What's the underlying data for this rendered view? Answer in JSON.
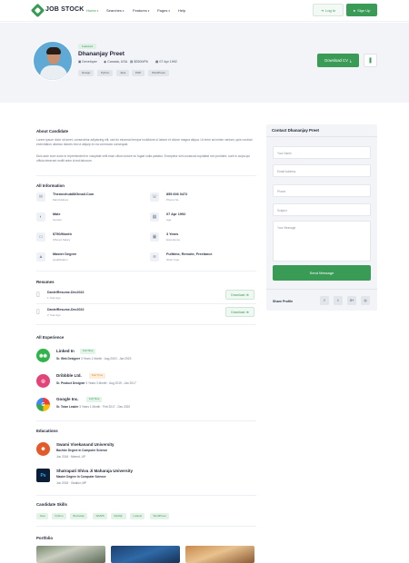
{
  "brand": {
    "name": "JOB STOCK",
    "accent": "#3a9b57"
  },
  "nav": {
    "items": [
      {
        "label": "Home",
        "caret": "▾",
        "active": true
      },
      {
        "label": "Searches",
        "caret": "▾"
      },
      {
        "label": "Features",
        "caret": "▾"
      },
      {
        "label": "Pages",
        "caret": "▾"
      },
      {
        "label": "Help",
        "caret": ""
      }
    ],
    "login": "Log In",
    "signup": "Sign Up"
  },
  "profile": {
    "badge": "Featured",
    "name": "Dhananjay Preet",
    "meta": [
      {
        "icon": "briefcase-icon",
        "text": "Developer"
      },
      {
        "icon": "location-icon",
        "text": "Canada, USA"
      },
      {
        "icon": "money-icon",
        "text": "$2500/PA"
      },
      {
        "icon": "calendar-icon",
        "text": "07 Apr 1992"
      }
    ],
    "skills": [
      "Design",
      "Python",
      "Java",
      "PHP",
      "WordPress"
    ],
    "download_cv": "Download CV",
    "bookmark_icon": "bookmark-icon"
  },
  "about": {
    "title": "About Candidate",
    "p1": "Lorem ipsum dolor sit amet, consectetur adipiscing elit, sed do eiusmod tempor incididunt ut labore et dolore magna aliqua. Ut enim ad minim veniam, quis nostrud exercitation ullamco laboris nisi ut aliquip ex ea commodo consequat.",
    "p2": "Duis aute irure dolor in reprehenderit in voluptate velit esse cillum dolore eu fugiat nulla pariatur. Excepteur sint occaecat cupidatat non proident, sunt in culpa qui officia deserunt mollit anim id est laborum."
  },
  "info": {
    "title": "All Information",
    "items": [
      {
        "icon": "mail-icon",
        "value": "Themezhub88Gmail.Com",
        "label": "Mail Address"
      },
      {
        "icon": "phone-icon",
        "value": "855 606 0472",
        "label": "Phone No."
      },
      {
        "icon": "user-icon",
        "value": "Male",
        "label": "Gender"
      },
      {
        "icon": "calendar-icon",
        "value": "07 Apr 1992",
        "label": "Age"
      },
      {
        "icon": "wallet-icon",
        "value": "$750/Month",
        "label": "Offered Salary"
      },
      {
        "icon": "briefcase-icon",
        "value": "3 Years",
        "label": "Experience"
      },
      {
        "icon": "degree-icon",
        "value": "Master Degree",
        "label": "Qualification"
      },
      {
        "icon": "layers-icon",
        "value": "Fulltime, Remote, Freelance",
        "label": "Work Type"
      }
    ]
  },
  "resumes": {
    "title": "Resumes",
    "items": [
      {
        "name": "DanielResume-Dec2022",
        "date": "1 Year Ago",
        "action": "Download"
      },
      {
        "name": "DanielResume-Dec2022",
        "date": "2 Year Ago",
        "action": "Download"
      }
    ]
  },
  "experience": {
    "title": "All Experience",
    "items": [
      {
        "company": "Linked In",
        "badge": "Full Time",
        "badge_color": "#3a9b57",
        "badge_bg": "#e2f3e7",
        "role": "Sr. Web Designer",
        "period": "3 Years 1 Month · Aug 2019 - Jan 2023",
        "logo": "linkedin-icon",
        "logo_bg": "#2fb34a"
      },
      {
        "company": "Dribbble Ltd.",
        "badge": "Part Time",
        "badge_color": "#e08a2a",
        "badge_bg": "#fdeedc",
        "role": "Sr. Product Designer",
        "period": "3 Years 3 Month · Aug 2019 - Jan 2017",
        "logo": "dribbble-icon",
        "logo_bg": "#e14478"
      },
      {
        "company": "Google Inc.",
        "badge": "Full Time",
        "badge_color": "#3a9b57",
        "badge_bg": "#e2f3e7",
        "role": "Sr. Team Leader",
        "period": "3 Years 1 Month · Feb 2017 - Dec 2020",
        "logo": "google-icon",
        "logo_bg": "#f0c33c"
      }
    ]
  },
  "education": {
    "title": "Educations",
    "items": [
      {
        "school": "Swami Vivekanand University",
        "degree": "Bachlor Degree In Computer Science",
        "meta": "Jun 2016 · Meerut, UP",
        "logo_bg": "#e35a2b"
      },
      {
        "school": "Shatrapati Shiva Ji Maharaja University",
        "degree": "Master Degree In Computer Science",
        "meta": "Jun 2015 · Gwalior, MP",
        "logo_bg": "#0c1e35"
      }
    ]
  },
  "candidate_skills": {
    "title": "Candidate Skills",
    "items": [
      "Java",
      "Python",
      "Bootstrap",
      "WHMS",
      "MySQL",
      "Laravel",
      "WordPress"
    ]
  },
  "portfolio": {
    "title": "Portfolio"
  },
  "contact": {
    "title": "Contact Dhananjay Preet",
    "name_ph": "Your Name",
    "email_ph": "Email Address",
    "phone_ph": "Phone",
    "subject_ph": "Subject",
    "message_ph": "Your Message",
    "send": "Send Message"
  },
  "share": {
    "title": "Share Profile",
    "items": [
      {
        "icon": "facebook-icon",
        "glyph": "f"
      },
      {
        "icon": "twitter-icon",
        "glyph": "t"
      },
      {
        "icon": "google-plus-icon",
        "glyph": "G+"
      },
      {
        "icon": "instagram-icon",
        "glyph": "◎"
      }
    ]
  }
}
